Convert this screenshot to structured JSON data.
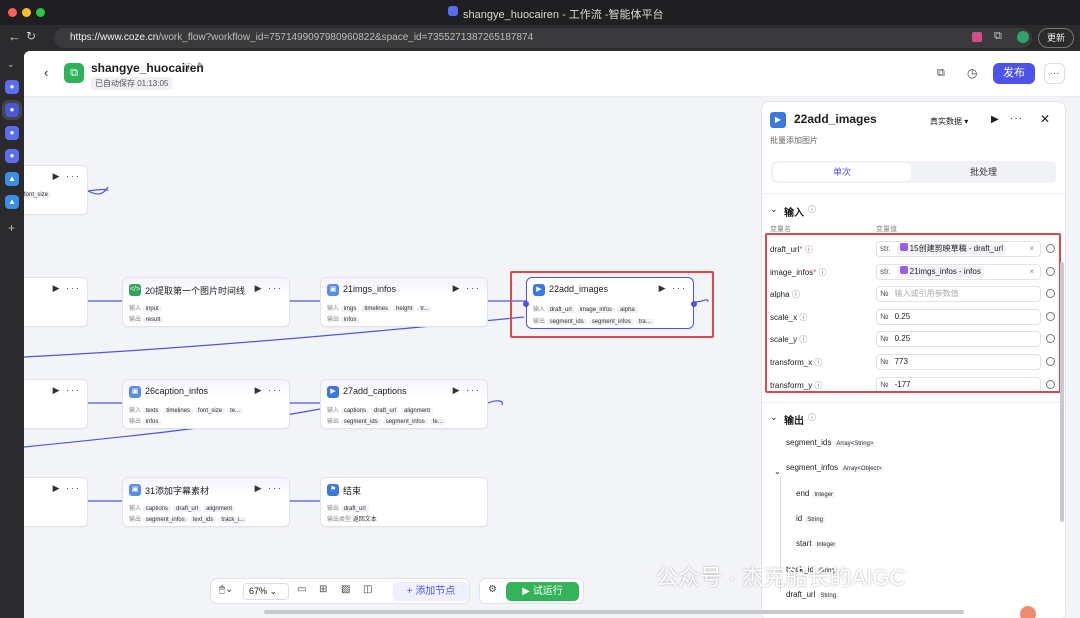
{
  "window": {
    "title": "shangye_huocairen - 工作流 -智能体平台"
  },
  "browser": {
    "url_host": "https://www.coze.cn",
    "url_path": "/work_flow?workflow_id=7571499097980960822&space_id=7355271387265187874",
    "new_btn": "更新"
  },
  "header": {
    "title": "shangye_huocairen",
    "autosave": "已自动保存 01:13:05",
    "publish": "发布"
  },
  "nodes": {
    "n0": {
      "row": "font_size"
    },
    "n20": {
      "title": "20提取第一个图片时间线",
      "in_label": "输入",
      "in_tags": [
        "input"
      ],
      "out_label": "输出",
      "out_tags": [
        "result"
      ]
    },
    "n21": {
      "title": "21imgs_infos",
      "in_label": "输入",
      "in_tags": [
        "imgs",
        "timelines",
        "height",
        "tr..."
      ],
      "out_label": "输出",
      "out_tags": [
        "infos"
      ]
    },
    "n22": {
      "title": "22add_images",
      "in_label": "输入",
      "in_tags": [
        "draft_url",
        "image_infos",
        "alpha"
      ],
      "out_label": "输出",
      "out_tags": [
        "segment_ids",
        "segment_infos",
        "tra..."
      ]
    },
    "n26": {
      "title": "26caption_infos",
      "in_label": "输入",
      "in_tags": [
        "texts",
        "timelines",
        "font_size",
        "te..."
      ],
      "out_label": "输出",
      "out_tags": [
        "infos"
      ]
    },
    "n27": {
      "title": "27add_captions",
      "in_label": "输入",
      "in_tags": [
        "captions",
        "draft_url",
        "alignment"
      ],
      "out_label": "输出",
      "out_tags": [
        "segment_ids",
        "segment_infos",
        "te..."
      ]
    },
    "n31": {
      "title": "31添加字幕素材",
      "in_label": "输入",
      "in_tags": [
        "captions",
        "draft_url",
        "alignment"
      ],
      "out_label": "输出",
      "out_tags": [
        "segment_infos",
        "text_ids",
        "track_i..."
      ]
    },
    "nend": {
      "title": "结束",
      "in_label": "输出",
      "in_tags": [
        "draft_url"
      ],
      "out_label": "输出类型",
      "out_value": "返回文本"
    }
  },
  "toolbar": {
    "zoom": "67%",
    "add_node": "添加节点",
    "run": "试运行"
  },
  "panel": {
    "title": "22add_images",
    "data_mode": "真实数据",
    "desc": "批量添加图片",
    "tabs": [
      "单次",
      "批处理"
    ],
    "input_section": "输入",
    "col_name": "变量名",
    "col_value": "变量值",
    "inputs": [
      {
        "name": "draft_url",
        "required": "*",
        "type": "str.",
        "value": "15创建剪映草稿 - draft_url",
        "ref": true
      },
      {
        "name": "image_infos",
        "required": "*",
        "type": "str.",
        "value": "21imgs_infos - infos",
        "ref": true
      },
      {
        "name": "alpha",
        "required": "",
        "type": "№",
        "value": "输入或引用参数值",
        "placeholder": true
      },
      {
        "name": "scale_x",
        "required": "",
        "type": "№",
        "value": "0.25"
      },
      {
        "name": "scale_y",
        "required": "",
        "type": "№",
        "value": "0.25"
      },
      {
        "name": "transform_x",
        "required": "",
        "type": "№",
        "value": "773"
      },
      {
        "name": "transform_y",
        "required": "",
        "type": "№",
        "value": "-177"
      }
    ],
    "output_section": "输出",
    "outputs": [
      {
        "name": "segment_ids",
        "type": "Array<String>"
      },
      {
        "name": "segment_infos",
        "type": "Array<Object>"
      },
      {
        "name": "end",
        "type": "Integer"
      },
      {
        "name": "id",
        "type": "String"
      },
      {
        "name": "start",
        "type": "Integer"
      },
      {
        "name": "track_id",
        "type": "String"
      },
      {
        "name": "draft_url",
        "type": "String"
      }
    ]
  },
  "watermark": "公众号 · 杰克船长的AIGC"
}
